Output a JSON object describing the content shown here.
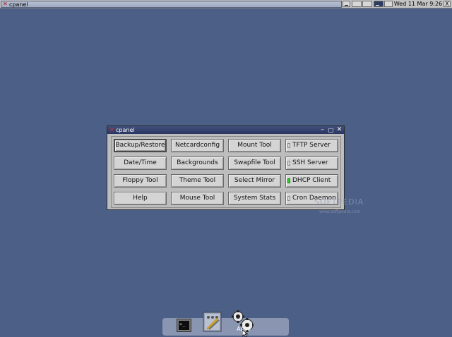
{
  "taskbar": {
    "task_title": "cpanel",
    "clock": "Wed 11 Mar  9:26",
    "close_glyph": "X"
  },
  "window": {
    "title": "cpanel",
    "controls": {
      "minimize": "–",
      "maximize": "□",
      "close": "✕"
    },
    "buttons": [
      {
        "label": "Backup/Restore"
      },
      {
        "label": "Netcardconfig"
      },
      {
        "label": "Mount Tool"
      },
      {
        "label": "Date/Time"
      },
      {
        "label": "Backgrounds"
      },
      {
        "label": "Swapfile Tool"
      },
      {
        "label": "Floppy Tool"
      },
      {
        "label": "Theme Tool"
      },
      {
        "label": "Select Mirror"
      },
      {
        "label": "Help"
      },
      {
        "label": "Mouse Tool"
      },
      {
        "label": "System Stats"
      }
    ],
    "services": [
      {
        "label": "TFTP Server",
        "on": false
      },
      {
        "label": "SSH Server",
        "on": false
      },
      {
        "label": "DHCP Client",
        "on": true
      },
      {
        "label": "Cron Daemon",
        "on": false
      }
    ]
  },
  "watermark": {
    "main": "SOFTPEDIA",
    "sub": "www.softpedia.com"
  },
  "dock": {
    "apps_label": "Apps",
    "icons": [
      "terminal-icon",
      "settings-icon",
      "gears-icon"
    ]
  },
  "colors": {
    "desktop": "#4c5f86",
    "indicator_on": "#2fce2f",
    "titlebar": "#2a3661"
  }
}
